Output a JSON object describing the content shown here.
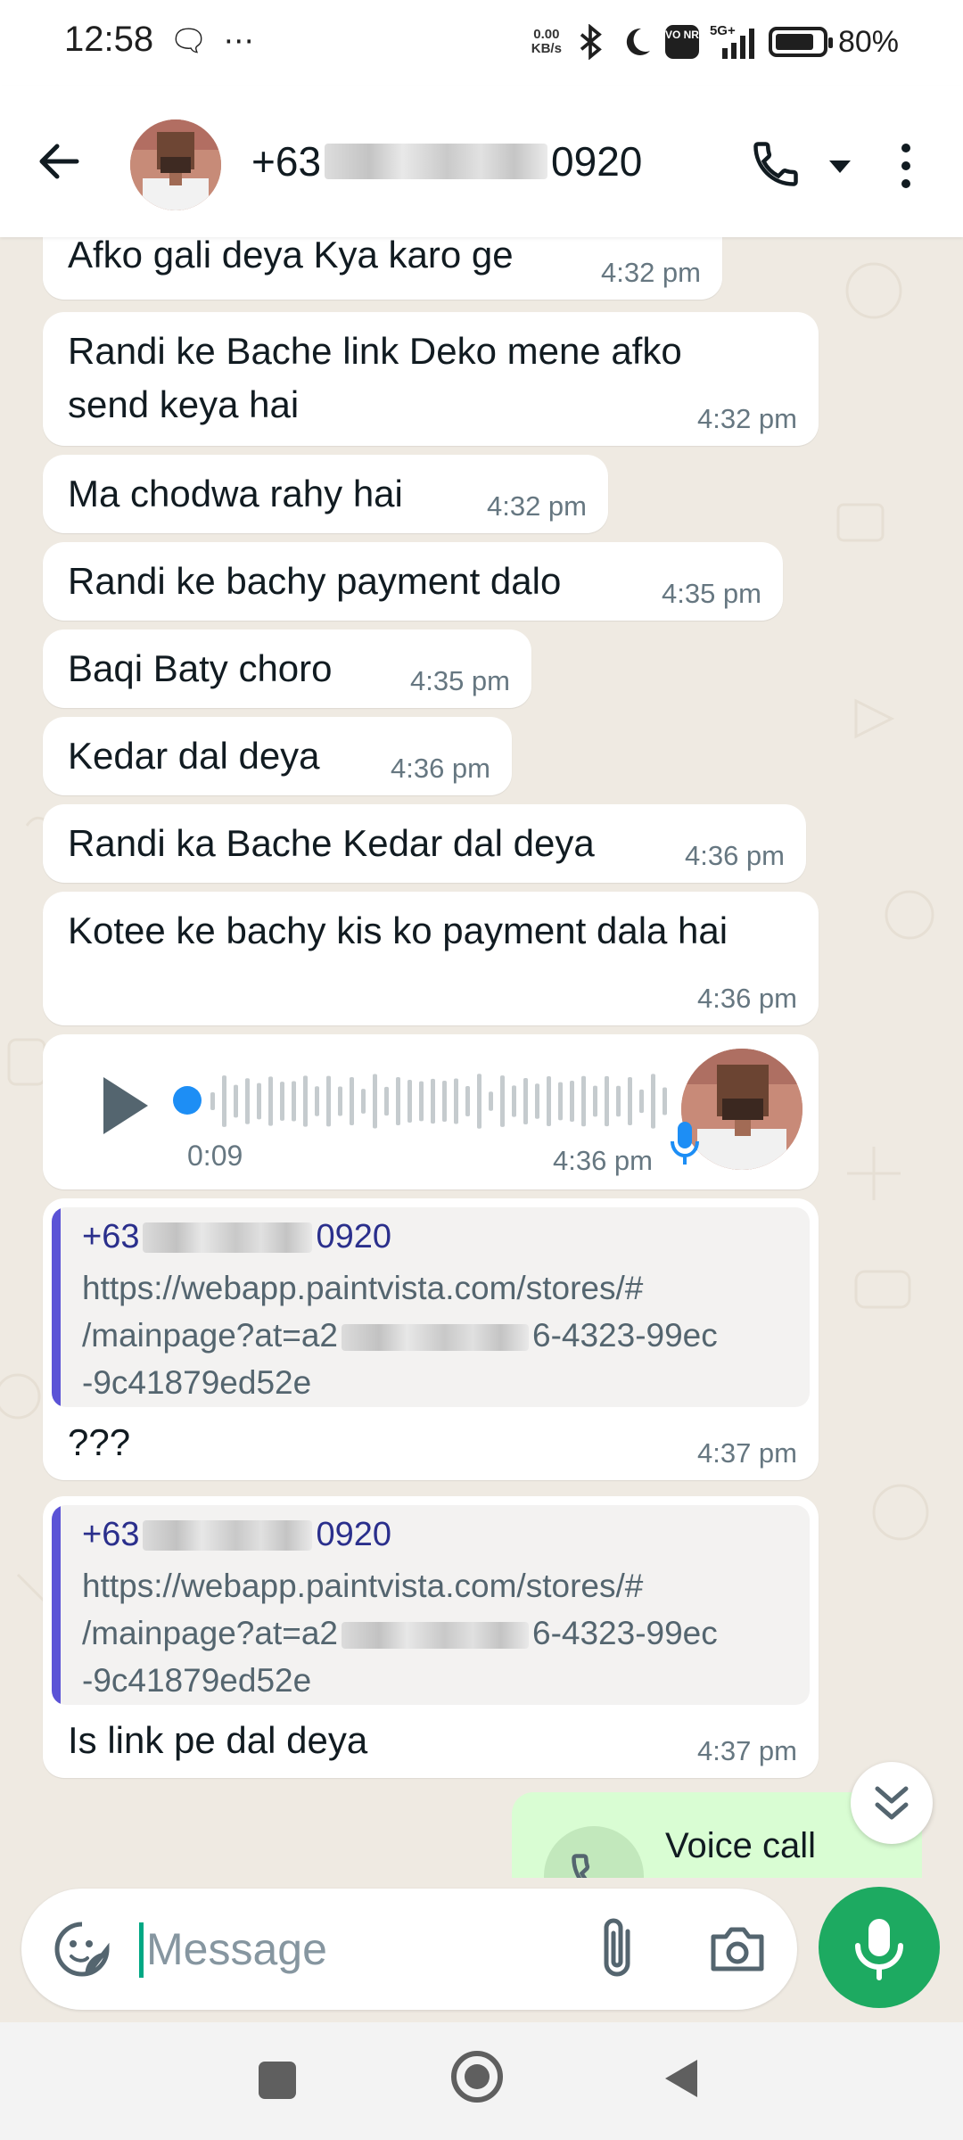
{
  "status_bar": {
    "time": "12:58",
    "left_icons": "🗨 ⋯",
    "net_speed_value": "0.00",
    "net_speed_unit": "KB/s",
    "volte_label": "VO NR",
    "network_label": "5G+",
    "battery": "80%"
  },
  "header": {
    "contact_prefix": "+63",
    "contact_suffix": "0920"
  },
  "messages": [
    {
      "text": "Afko gali deya Kya karo ge",
      "time": "4:32 pm"
    },
    {
      "text": "Randi ke Bache link Deko mene afko send keya hai",
      "time": "4:32 pm"
    },
    {
      "text": "Ma chodwa rahy hai",
      "time": "4:32 pm"
    },
    {
      "text": "Randi ke bachy payment dalo",
      "time": "4:35 pm"
    },
    {
      "text": "Baqi Baty choro",
      "time": "4:35 pm"
    },
    {
      "text": "Kedar dal deya",
      "time": "4:36 pm"
    },
    {
      "text": "Randi ka Bache Kedar dal deya",
      "time": "4:36 pm"
    },
    {
      "text": "Kotee ke bachy kis ko payment dala hai",
      "time": "4:36 pm"
    }
  ],
  "voice_note": {
    "duration": "0:09",
    "time": "4:36 pm",
    "progress": 0
  },
  "quoted_replies": [
    {
      "quote_author_prefix": "+63",
      "quote_author_suffix": "0920",
      "quote_line1": "https://webapp.paintvista.com/stores/#",
      "quote_line2_start": "/mainpage?at=a2",
      "quote_line2_end": "6-4323-99ec",
      "quote_line3": "-9c41879ed52e",
      "reply": "???",
      "time": "4:37 pm"
    },
    {
      "quote_author_prefix": "+63",
      "quote_author_suffix": "0920",
      "quote_line1": "https://webapp.paintvista.com/stores/#",
      "quote_line2_start": "/mainpage?at=a2",
      "quote_line2_end": "6-4323-99ec",
      "quote_line3": "-9c41879ed52e",
      "reply": "Is link pe dal deya",
      "time": "4:37 pm"
    }
  ],
  "outgoing_call": {
    "label": "Voice call"
  },
  "input": {
    "placeholder": "Message"
  },
  "colors": {
    "chat_background": "#efeae2",
    "incoming_bubble": "#ffffff",
    "outgoing_bubble": "#d9fdd3",
    "accent_green": "#1daa61",
    "quote_bar": "#5b53d6",
    "voice_dot": "#1d8ef5"
  },
  "icons": {
    "back": "arrow-left-icon",
    "call": "phone-icon",
    "dropdown": "caret-down-icon",
    "menu": "more-vert-icon",
    "play": "play-icon",
    "emoji": "sticker-icon",
    "attach": "paperclip-icon",
    "camera": "camera-icon",
    "mic": "mic-icon",
    "scroll": "double-chevron-down-icon"
  }
}
